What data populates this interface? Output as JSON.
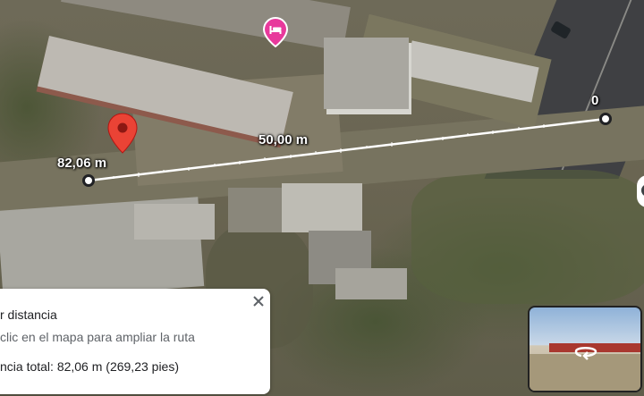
{
  "map": {
    "type": "satellite",
    "distance_labels": {
      "start": "82,06 m",
      "middle": "50,00 m",
      "end": "0"
    },
    "pin_color": "#ea4335",
    "hotel_pin_color": "#e8399c",
    "line_color": "#ffffff"
  },
  "distance_card": {
    "title": "r distancia",
    "hint": "clic en el mapa para ampliar la ruta",
    "total": "ncia total: 82,06 m (269,23 pies)",
    "close_icon": "close-icon"
  },
  "street_view": {
    "icon": "rotate-360-icon"
  }
}
